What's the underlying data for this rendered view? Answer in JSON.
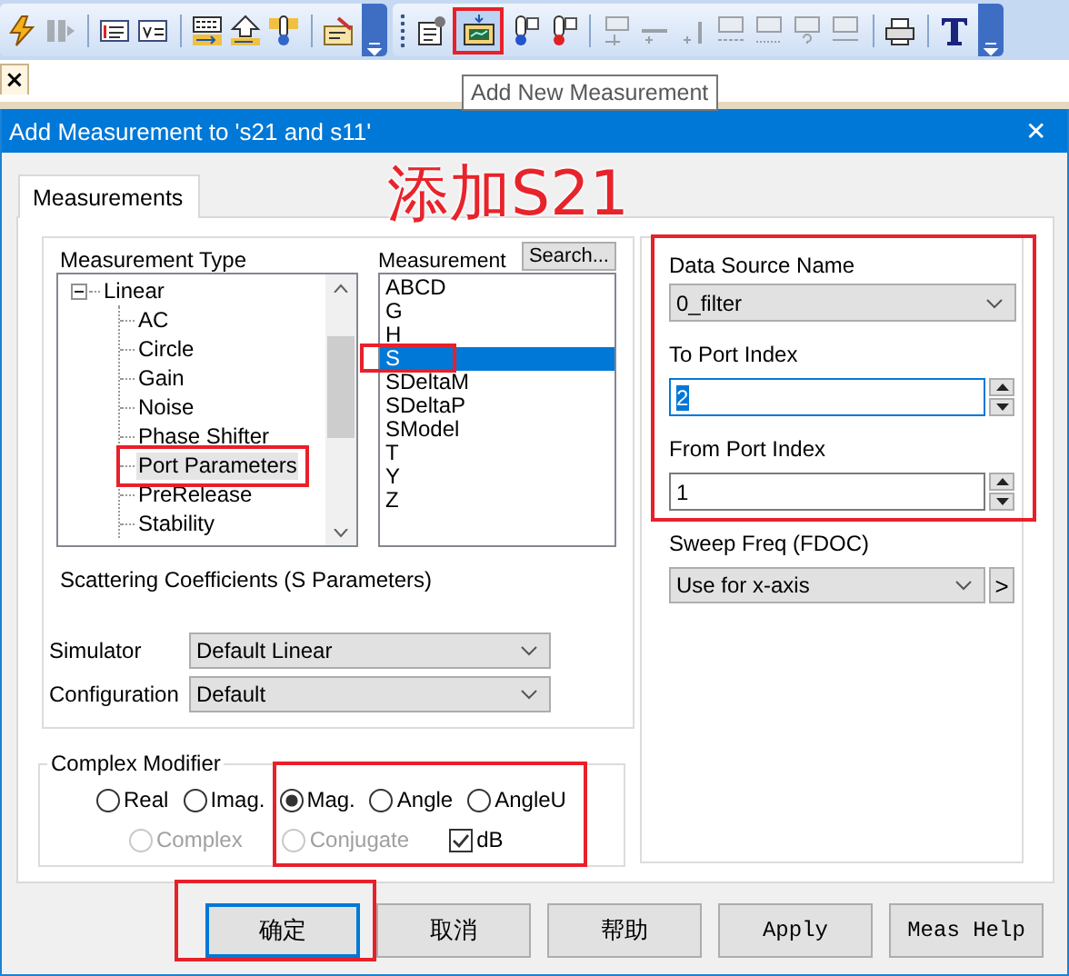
{
  "toolbar": {
    "groups": [
      {
        "sections": [
          {
            "buttons": [
              {
                "kind": "lightning",
                "disabled": false,
                "highlighted": false
              },
              {
                "kind": "pause",
                "disabled": true,
                "highlighted": false
              }
            ]
          },
          {
            "buttons": [
              {
                "kind": "list",
                "disabled": false,
                "highlighted": false
              },
              {
                "kind": "variable",
                "disabled": false,
                "highlighted": false
              }
            ]
          },
          {
            "buttons": [
              {
                "kind": "binary",
                "disabled": false,
                "highlighted": false
              },
              {
                "kind": "upload",
                "disabled": false,
                "highlighted": false
              },
              {
                "kind": "thermometer",
                "disabled": false,
                "highlighted": false
              }
            ]
          },
          {
            "buttons": [
              {
                "kind": "edit",
                "disabled": false,
                "highlighted": false
              }
            ]
          }
        ]
      },
      {
        "sections": [
          {
            "buttons": [
              {
                "kind": "properties",
                "disabled": false,
                "highlighted": false
              },
              {
                "kind": "measurement",
                "disabled": false,
                "highlighted": true
              },
              {
                "kind": "thermometer_blue",
                "disabled": false,
                "highlighted": false
              },
              {
                "kind": "thermometer_red",
                "disabled": false,
                "highlighted": false
              }
            ]
          },
          {
            "buttons": [
              {
                "kind": "marker",
                "disabled": true,
                "highlighted": false
              },
              {
                "kind": "marker_minus",
                "disabled": true,
                "highlighted": false
              },
              {
                "kind": "marker_plus",
                "disabled": true,
                "highlighted": false
              },
              {
                "kind": "max",
                "disabled": true,
                "highlighted": false
              },
              {
                "kind": "min",
                "disabled": true,
                "highlighted": false
              },
              {
                "kind": "query",
                "disabled": true,
                "highlighted": false
              },
              {
                "kind": "ref",
                "disabled": true,
                "highlighted": false
              }
            ]
          },
          {
            "buttons": [
              {
                "kind": "printer",
                "disabled": false,
                "highlighted": false
              }
            ]
          },
          {
            "buttons": [
              {
                "kind": "text",
                "disabled": false,
                "highlighted": false
              }
            ]
          }
        ]
      }
    ]
  },
  "tooltip": "Add New Measurement",
  "document_tab": {
    "close": "×"
  },
  "annotation": "添加S21",
  "dialog": {
    "title": "Add Measurement to 's21 and s11'",
    "close": "✕",
    "tabs": [
      {
        "label": "Measurements",
        "selected": true
      }
    ],
    "measurement_type": {
      "label": "Measurement Type",
      "tree": [
        {
          "label": "Linear",
          "expanded": true,
          "selected": false,
          "highlighted": false,
          "children": [
            {
              "label": "AC",
              "selected": false,
              "highlighted": false
            },
            {
              "label": "Circle",
              "selected": false,
              "highlighted": false
            },
            {
              "label": "Gain",
              "selected": false,
              "highlighted": false
            },
            {
              "label": "Noise",
              "selected": false,
              "highlighted": false
            },
            {
              "label": "Phase Shifter",
              "selected": false,
              "highlighted": false
            },
            {
              "label": "Port Parameters",
              "selected": true,
              "highlighted": true
            },
            {
              "label": "PreRelease",
              "selected": false,
              "highlighted": false
            },
            {
              "label": "Stability",
              "selected": false,
              "highlighted": false
            }
          ]
        }
      ]
    },
    "measurement": {
      "label": "Measurement",
      "search": "Search...",
      "items": [
        {
          "label": "ABCD",
          "selected": false,
          "highlighted": false
        },
        {
          "label": "G",
          "selected": false,
          "highlighted": false
        },
        {
          "label": "H",
          "selected": false,
          "highlighted": false
        },
        {
          "label": "S",
          "selected": true,
          "highlighted": true
        },
        {
          "label": "SDeltaM",
          "selected": false,
          "highlighted": false
        },
        {
          "label": "SDeltaP",
          "selected": false,
          "highlighted": false
        },
        {
          "label": "SModel",
          "selected": false,
          "highlighted": false
        },
        {
          "label": "T",
          "selected": false,
          "highlighted": false
        },
        {
          "label": "Y",
          "selected": false,
          "highlighted": false
        },
        {
          "label": "Z",
          "selected": false,
          "highlighted": false
        }
      ]
    },
    "description": "Scattering Coefficients (S Parameters)",
    "simulator": {
      "label": "Simulator",
      "value": "Default Linear"
    },
    "configuration": {
      "label": "Configuration",
      "value": "Default"
    },
    "complex_modifier": {
      "title": "Complex Modifier",
      "highlighted": true,
      "lines": [
        {
          "options": [
            {
              "kind": "radio",
              "label": "Real",
              "selected": false,
              "disabled": false
            },
            {
              "kind": "radio",
              "label": "Imag.",
              "selected": false,
              "disabled": false
            },
            {
              "kind": "radio",
              "label": "Mag.",
              "selected": true,
              "disabled": false
            },
            {
              "kind": "radio",
              "label": "Angle",
              "selected": false,
              "disabled": false
            },
            {
              "kind": "radio",
              "label": "AngleU",
              "selected": false,
              "disabled": false
            }
          ]
        },
        {
          "options": [
            {
              "kind": "radio",
              "label": "Complex",
              "selected": false,
              "disabled": true
            },
            {
              "kind": "radio",
              "label": "Conjugate",
              "selected": false,
              "disabled": true
            },
            {
              "kind": "checkbox",
              "label": "dB",
              "selected": true,
              "disabled": false
            }
          ]
        }
      ]
    },
    "source": {
      "highlighted": true,
      "data_source": {
        "label": "Data Source Name",
        "value": "0_filter"
      },
      "to_port": {
        "label": "To Port Index",
        "value": "2",
        "focused": true
      },
      "from_port": {
        "label": "From Port Index",
        "value": "1",
        "focused": false
      }
    },
    "sweep": {
      "label": "Sweep Freq (FDOC)",
      "value": "Use for x-axis",
      "more": ">"
    },
    "buttons": [
      {
        "label": "确定",
        "kind": "system",
        "default": true,
        "highlighted": true
      },
      {
        "label": "取消",
        "kind": "system",
        "default": false,
        "highlighted": false
      },
      {
        "label": "帮助",
        "kind": "system",
        "default": false,
        "highlighted": false
      },
      {
        "label": "Apply",
        "kind": "app",
        "default": false,
        "highlighted": false
      },
      {
        "label": "Meas Help",
        "kind": "app",
        "default": false,
        "highlighted": false
      }
    ]
  }
}
